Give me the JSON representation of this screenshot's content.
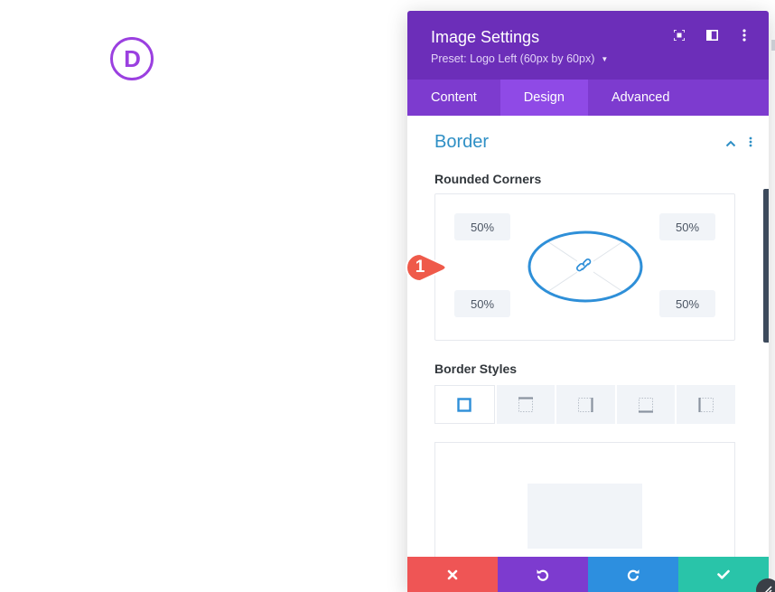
{
  "logo": {
    "letter": "D",
    "color": "#9b40e0"
  },
  "panel": {
    "title": "Image Settings",
    "preset": "Preset: Logo Left (60px by 60px)",
    "header_icons": [
      "focus-mode-icon",
      "split-view-icon",
      "more-options-icon"
    ]
  },
  "tabs": [
    {
      "label": "Content",
      "active": false
    },
    {
      "label": "Design",
      "active": true
    },
    {
      "label": "Advanced",
      "active": false
    }
  ],
  "section": {
    "title": "Border",
    "expanded": true
  },
  "rounded_corners": {
    "label": "Rounded Corners",
    "top_left": "50%",
    "top_right": "50%",
    "bottom_left": "50%",
    "bottom_right": "50%",
    "linked": true
  },
  "border_styles": {
    "label": "Border Styles",
    "options": [
      "all-sides-icon",
      "top-side-icon",
      "right-side-icon",
      "bottom-side-icon",
      "left-side-icon"
    ],
    "active_index": 0
  },
  "callout": {
    "number": "1",
    "color": "#ef5a4a"
  },
  "footer": [
    "discard-icon",
    "undo-icon",
    "redo-icon",
    "save-icon"
  ],
  "colors": {
    "header": "#6c2eb9",
    "tabs": "#7d3bcf",
    "active_tab": "#8f4ae6",
    "section_title": "#2e8fc5",
    "discard": "#ef5555",
    "undo": "#7d3bcf",
    "redo": "#2d8fdf",
    "save": "#29c4a9"
  }
}
